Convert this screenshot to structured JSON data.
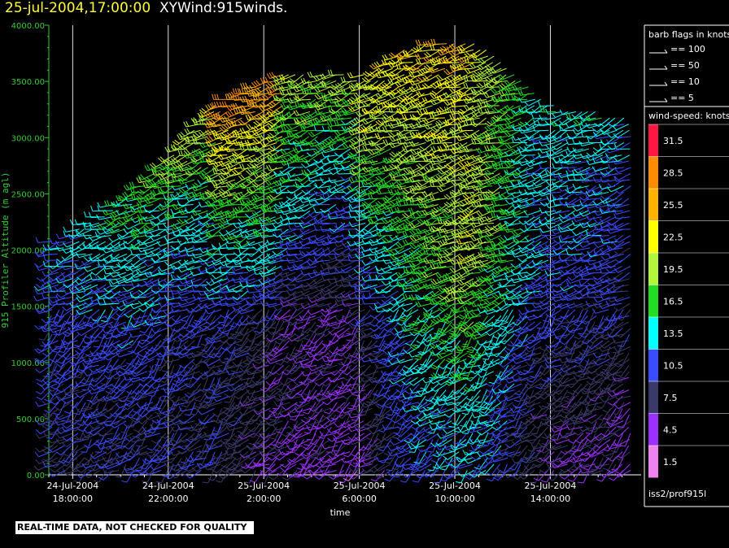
{
  "header": {
    "datetime": "25-jul-2004,17:00:00",
    "title": "XYWind:915winds."
  },
  "footer": {
    "quality_note": "REAL-TIME DATA, NOT CHECKED FOR QUALITY",
    "source": "iss2/prof915l"
  },
  "legend": {
    "barb_title": "barb flags in knots",
    "barbs": [
      "== 100",
      "== 50",
      "== 10",
      "== 5"
    ],
    "speed_title": "wind-speed: knots",
    "speed_labels": [
      "31.5",
      "28.5",
      "25.5",
      "22.5",
      "19.5",
      "16.5",
      "13.5",
      "10.5",
      "7.5",
      "4.5",
      "1.5"
    ],
    "speed_colors": [
      "#ff1744",
      "#ff8c00",
      "#ffb300",
      "#ffff00",
      "#b2f53a",
      "#22dd22",
      "#00ffff",
      "#3a4cff",
      "#3a3a6a",
      "#9b30ff",
      "#ee82ee"
    ]
  },
  "chart_data": {
    "type": "scatter",
    "title": "",
    "xlabel": "time",
    "ylabel": "915 Profiler Altitude (m agl)",
    "ylim": [
      0,
      4000
    ],
    "yticks": [
      "0.00",
      "500.00",
      "1000.00",
      "1500.00",
      "2000.00",
      "2500.00",
      "3000.00",
      "3500.00",
      "4000.00"
    ],
    "xticks": [
      {
        "date": "24-Jul-2004",
        "time": "18:00:00"
      },
      {
        "date": "24-Jul-2004",
        "time": "22:00:00"
      },
      {
        "date": "25-Jul-2004",
        "time": "2:00:00"
      },
      {
        "date": "25-Jul-2004",
        "time": "6:00:00"
      },
      {
        "date": "25-Jul-2004",
        "time": "10:00:00"
      },
      {
        "date": "25-Jul-2004",
        "time": "14:00:00"
      }
    ],
    "x_hours_range": [
      -1,
      23.8
    ],
    "grid": "vertical lines at labeled times",
    "series": [
      {
        "kind": "wind barbs",
        "profiles": [
          {
            "h": -0.5,
            "top": 2100,
            "speeds": [
              8,
              9,
              10,
              10,
              11,
              12
            ]
          },
          {
            "h": 3,
            "top": 2600,
            "speeds": [
              9,
              9,
              10,
              12,
              14,
              17
            ]
          },
          {
            "h": 6,
            "top": 3300,
            "speeds": [
              8,
              9,
              9,
              12,
              15,
              22,
              28
            ]
          },
          {
            "h": 9,
            "top": 3600,
            "speeds": [
              5,
              6,
              6,
              12,
              16,
              20
            ]
          },
          {
            "h": 12,
            "top": 3550,
            "speeds": [
              4,
              5,
              6,
              10,
              14,
              19,
              22
            ]
          },
          {
            "h": 14.5,
            "top": 3850,
            "speeds": [
              10,
              12,
              14,
              16,
              18,
              21,
              24
            ]
          },
          {
            "h": 17,
            "top": 3850,
            "speeds": [
              12,
              14,
              17,
              21,
              20,
              22
            ]
          },
          {
            "h": 20,
            "top": 3300,
            "speeds": [
              6,
              7,
              9,
              11,
              12,
              13,
              14
            ]
          },
          {
            "h": 23,
            "top": 3200,
            "speeds": [
              5,
              6,
              8,
              10,
              11,
              12
            ]
          }
        ]
      }
    ]
  }
}
